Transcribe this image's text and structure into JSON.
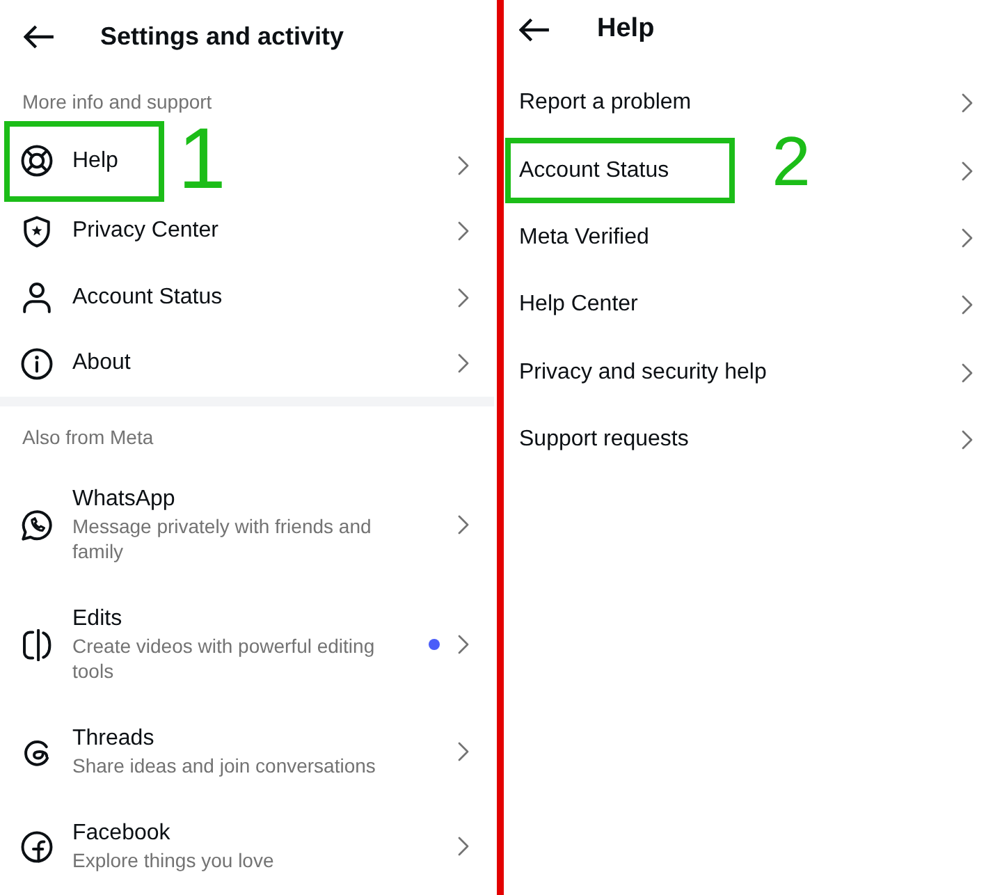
{
  "panels": [
    {
      "title": "Settings and activity",
      "sections": [
        {
          "heading": "More info and support",
          "items": [
            {
              "label": "Help",
              "annotation": {
                "number": "1"
              }
            },
            {
              "label": "Privacy Center"
            },
            {
              "label": "Account Status"
            },
            {
              "label": "About"
            }
          ]
        },
        {
          "heading": "Also from Meta",
          "items": [
            {
              "label": "WhatsApp",
              "description": "Message privately with friends and family",
              "unread": false
            },
            {
              "label": "Edits",
              "description": "Create videos with powerful editing tools",
              "unread": true
            },
            {
              "label": "Threads",
              "description": "Share ideas and join conversations",
              "unread": false
            },
            {
              "label": "Facebook",
              "description": "Explore things you love",
              "unread": false
            }
          ]
        }
      ]
    },
    {
      "title": "Help",
      "sections": [
        {
          "items": [
            {
              "label": "Report a problem"
            },
            {
              "label": "Account Status",
              "annotation": {
                "number": "2"
              }
            },
            {
              "label": "Meta Verified"
            },
            {
              "label": "Help Center"
            },
            {
              "label": "Privacy and security help"
            },
            {
              "label": "Support requests"
            }
          ]
        }
      ]
    }
  ]
}
